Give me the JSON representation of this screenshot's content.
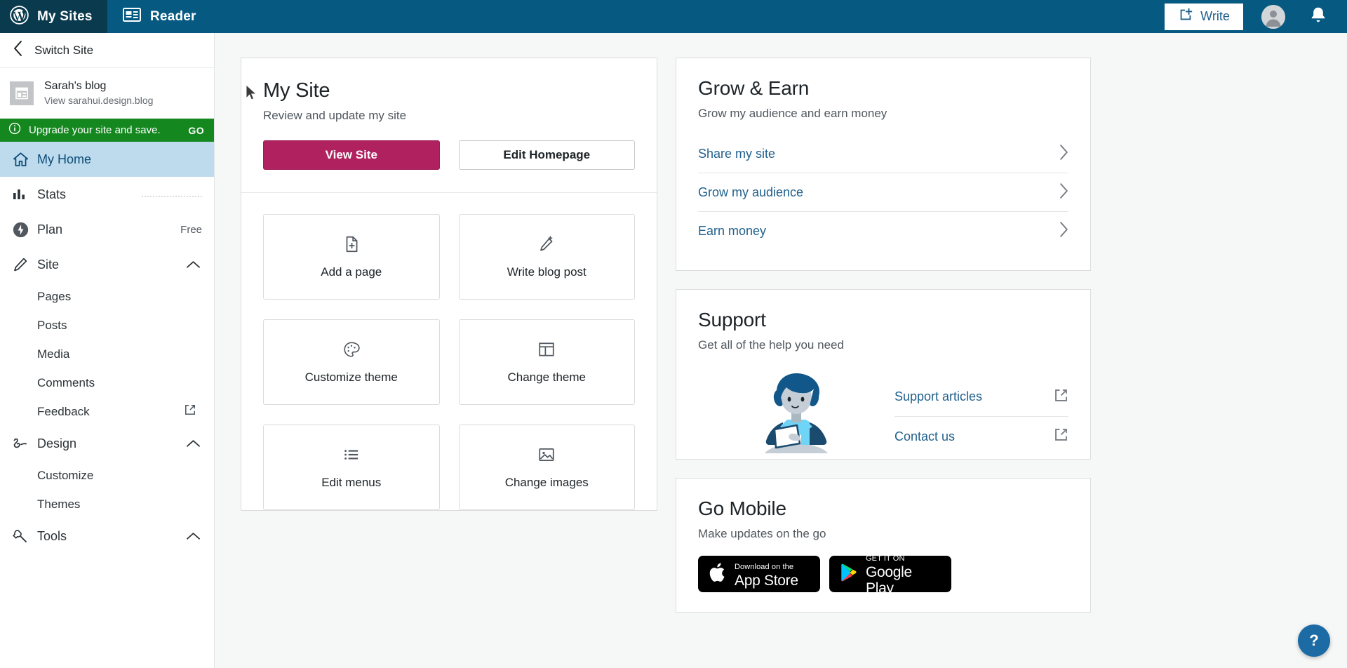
{
  "masterbar": {
    "my_sites": "My Sites",
    "reader": "Reader",
    "write": "Write",
    "wordpress_icon": "wordpress-logo-icon",
    "reader_icon": "reader-icon",
    "write_icon": "write-pencil-icon",
    "avatar_icon": "user-avatar-icon",
    "bell_icon": "notifications-bell-icon",
    "background": "#065a82",
    "mysites_background": "#0a3a4d"
  },
  "sidebar": {
    "switch_site": "Switch Site",
    "back_icon": "chevron-left-icon",
    "site": {
      "name": "Sarah's blog",
      "url": "View sarahui.design.blog",
      "thumb_icon": "site-layout-icon"
    },
    "upgrade": {
      "text": "Upgrade your site and save.",
      "action": "GO",
      "info_icon": "info-circle-icon",
      "background": "#14871f"
    },
    "items": [
      {
        "label": "My Home",
        "icon": "home-icon",
        "selected": true,
        "meta": ""
      },
      {
        "label": "Stats",
        "icon": "stats-bars-icon",
        "selected": false,
        "meta": ""
      },
      {
        "label": "Plan",
        "icon": "plan-bolt-icon",
        "selected": false,
        "meta": "Free"
      },
      {
        "label": "Site",
        "icon": "pencil-icon",
        "selected": false,
        "meta": "",
        "expanded": true
      }
    ],
    "site_children": [
      {
        "label": "Pages",
        "external": false
      },
      {
        "label": "Posts",
        "external": false
      },
      {
        "label": "Media",
        "external": false
      },
      {
        "label": "Comments",
        "external": false
      },
      {
        "label": "Feedback",
        "external": true
      }
    ],
    "design": {
      "label": "Design",
      "icon": "design-swirl-icon",
      "expanded": true
    },
    "design_children": [
      {
        "label": "Customize"
      },
      {
        "label": "Themes"
      }
    ],
    "tools": {
      "label": "Tools",
      "icon": "wrench-icon",
      "expanded": true
    },
    "selected_background": "#bedbee"
  },
  "my_site_card": {
    "title": "My Site",
    "subtitle": "Review and update my site",
    "primary_button": "View Site",
    "secondary_button": "Edit Homepage",
    "primary_color": "#b0215f",
    "tiles": [
      {
        "label": "Add a page",
        "icon": "add-page-icon"
      },
      {
        "label": "Write blog post",
        "icon": "write-post-icon"
      },
      {
        "label": "Customize theme",
        "icon": "palette-icon"
      },
      {
        "label": "Change theme",
        "icon": "theme-layout-icon"
      },
      {
        "label": "Edit menus",
        "icon": "menu-list-icon"
      },
      {
        "label": "Change images",
        "icon": "image-icon"
      }
    ]
  },
  "grow_earn": {
    "title": "Grow & Earn",
    "subtitle": "Grow my audience and earn money",
    "links": [
      {
        "label": "Share my site",
        "icon": "chevron-right-icon"
      },
      {
        "label": "Grow my audience",
        "icon": "chevron-right-icon"
      },
      {
        "label": "Earn money",
        "icon": "chevron-right-icon"
      }
    ]
  },
  "support": {
    "title": "Support",
    "subtitle": "Get all of the help you need",
    "illustration": "support-person-illustration",
    "links": [
      {
        "label": "Support articles",
        "icon": "external-link-icon"
      },
      {
        "label": "Contact us",
        "icon": "external-link-icon"
      }
    ]
  },
  "go_mobile": {
    "title": "Go Mobile",
    "subtitle": "Make updates on the go",
    "badges": [
      {
        "small": "Download on the",
        "big": "App Store",
        "icon": "apple-logo-icon"
      },
      {
        "small": "GET IT ON",
        "big": "Google Play",
        "icon": "google-play-icon"
      }
    ]
  },
  "help_fab": {
    "label": "?",
    "icon": "help-question-icon",
    "color": "#1d6ba4"
  }
}
